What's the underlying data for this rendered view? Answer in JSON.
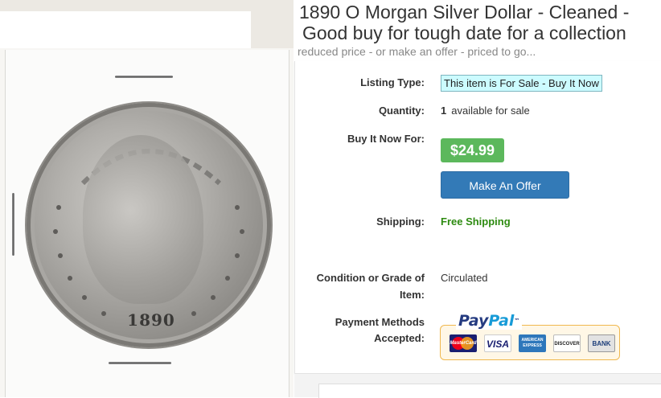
{
  "listing": {
    "title_line1": "1890 O Morgan Silver Dollar - Cleaned -",
    "title_line2": "Good buy for tough date for a  collection",
    "subtitle": "reduced price - or make an offer - priced to go..."
  },
  "photo": {
    "alt": "Morgan silver dollar in cardboard holder",
    "date_text": "1890"
  },
  "details": {
    "listing_type_label": "Listing Type:",
    "listing_type_value": "This item is For Sale - Buy It Now",
    "quantity_label": "Quantity:",
    "quantity_value": "1",
    "quantity_suffix": "available for sale",
    "buy_label": "Buy It Now For:",
    "price": "$24.99",
    "offer_button": "Make An Offer",
    "shipping_label": "Shipping:",
    "shipping_value": "Free Shipping",
    "condition_label_1": "Condition or Grade of",
    "condition_label_2": "Item:",
    "condition_value": "Circulated",
    "payment_label_1": "Payment Methods",
    "payment_label_2": "Accepted:"
  },
  "payment": {
    "paypal_pay": "Pay",
    "paypal_pal": "Pal",
    "paypal_tm": "™",
    "cards": {
      "mastercard": "MasterCard",
      "visa": "VISA",
      "amex_line1": "AMERICAN",
      "amex_line2": "EXPRESS",
      "discover": "DISCOVER",
      "bank": "BANK"
    }
  },
  "colors": {
    "price_green": "#5cb85c",
    "offer_blue": "#337ab7",
    "free_shipping_green": "#2e8b11",
    "sale_badge_bg": "#ccfbff"
  }
}
